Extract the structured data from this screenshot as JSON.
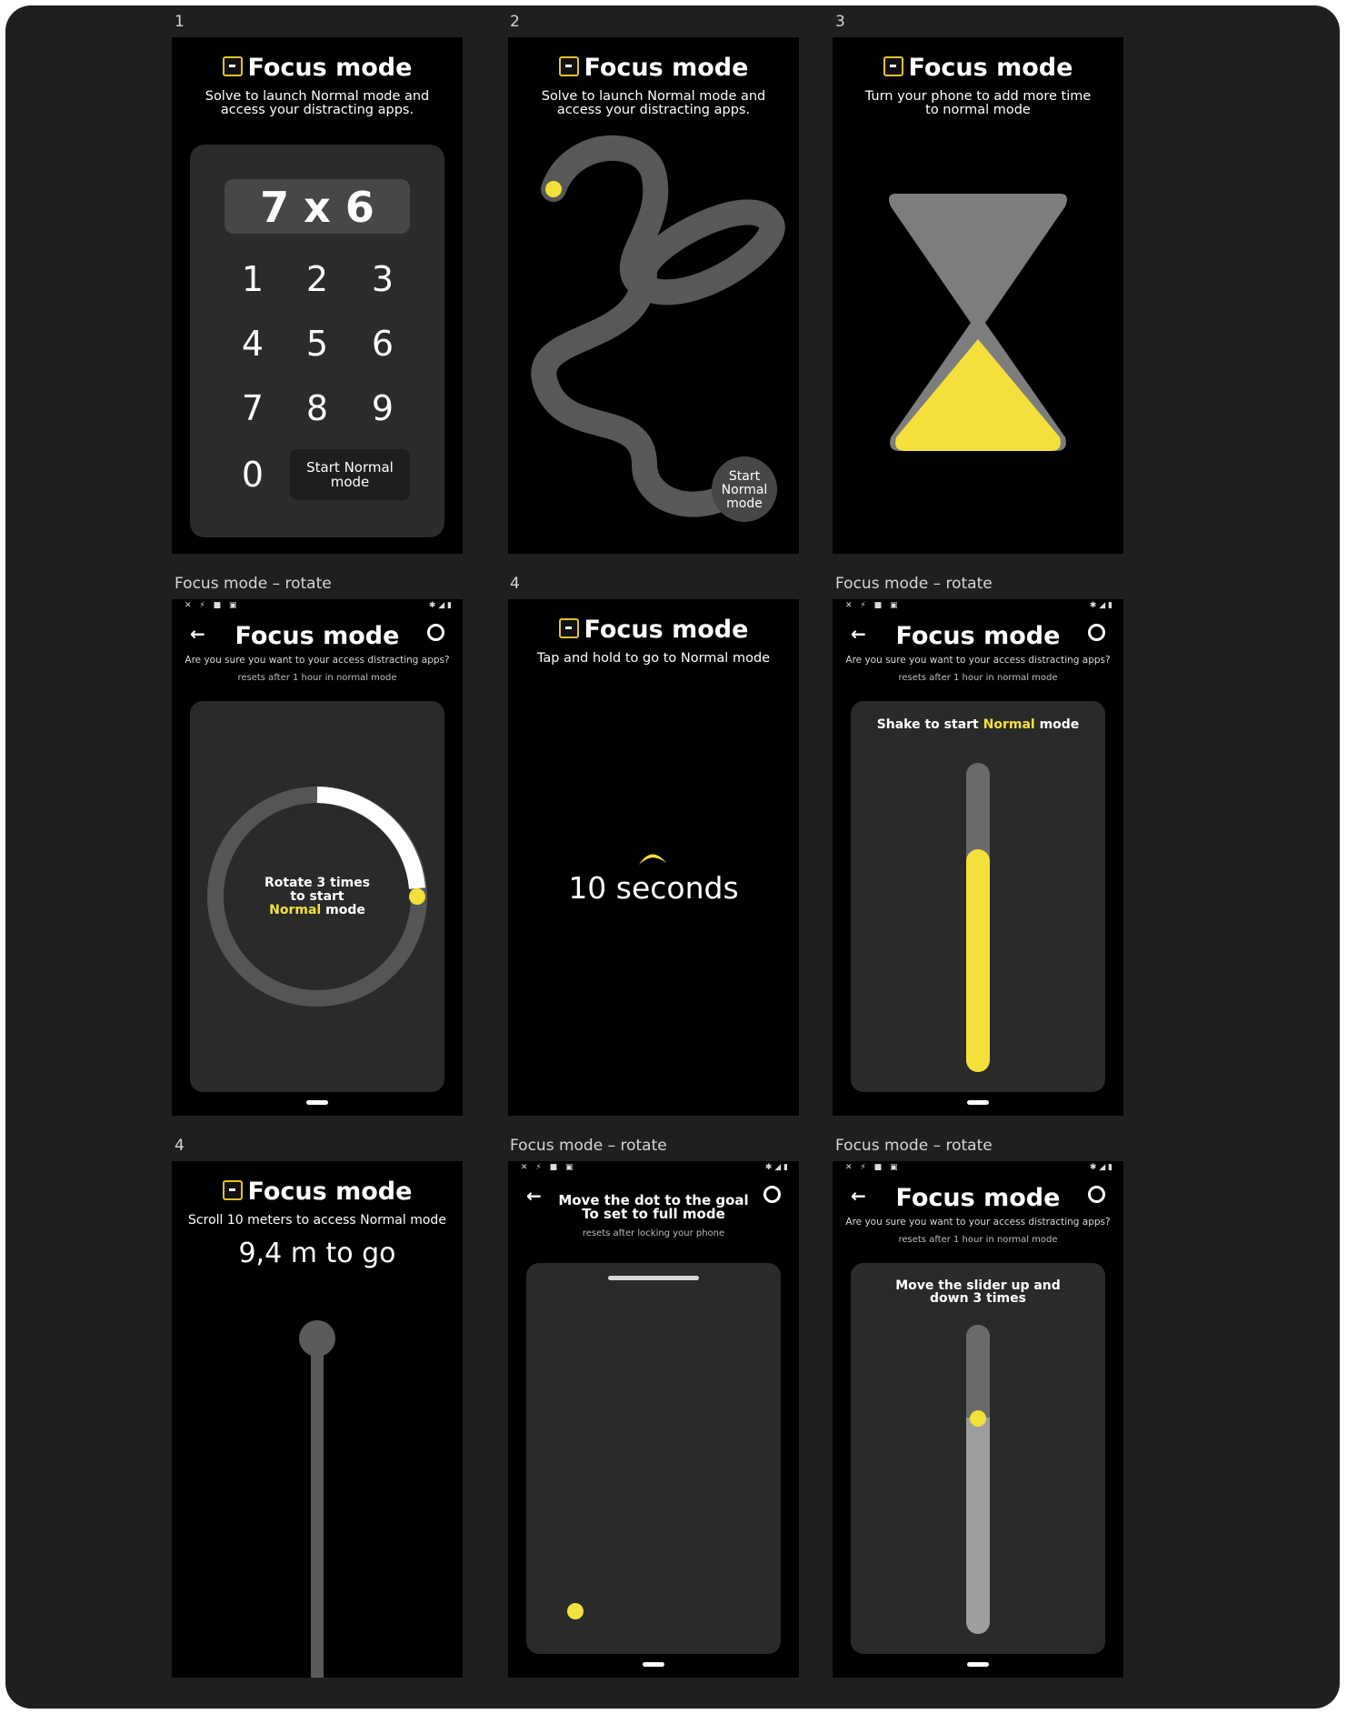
{
  "colors": {
    "accent": "#f3e03a",
    "board": "#1f1f1f",
    "track": "#555555"
  },
  "icons": [
    "focus-mode-logo-icon",
    "back-arrow-icon",
    "settings-gear-icon"
  ],
  "frames": [
    {
      "caption": "1",
      "title": "Focus mode",
      "subtitle": "Solve to launch Normal mode and access your distracting apps.",
      "equation": "7 x 6",
      "keys": [
        "1",
        "2",
        "3",
        "4",
        "5",
        "6",
        "7",
        "8",
        "9",
        "0"
      ],
      "start_button": "Start Normal mode"
    },
    {
      "caption": "2",
      "title": "Focus mode",
      "subtitle": "Solve to launch Normal mode and access your distracting apps.",
      "goal_label": "Start Normal mode"
    },
    {
      "caption": "3",
      "title": "Focus mode",
      "subtitle": "Turn your phone to add more time to normal mode"
    },
    {
      "caption": "Focus mode – rotate",
      "title": "Focus mode",
      "question": "Are you sure you want to your access distracting apps?",
      "note": "resets after 1 hour in normal mode",
      "center_line1": "Rotate 3 times",
      "center_line2": "to start",
      "center_highlight": "Normal",
      "center_line3": "mode",
      "progress_fraction": 0.3
    },
    {
      "caption": "4",
      "title": "Focus mode",
      "subtitle": "Tap and hold to go to Normal mode",
      "countdown": "10 seconds"
    },
    {
      "caption": "Focus mode – rotate",
      "title": "Focus mode",
      "question": "Are you sure you want to your access distracting apps?",
      "note": "resets after 1 hour in normal mode",
      "instruction_a": "Shake to start",
      "instruction_highlight": "Normal",
      "instruction_b": "mode",
      "fill_fraction": 0.72
    },
    {
      "caption": "4",
      "title": "Focus mode",
      "subtitle": "Scroll 10 meters to access Normal mode",
      "distance": "9,4 m to go"
    },
    {
      "caption": "Focus mode – rotate",
      "title": "Move the dot to the goal",
      "title2": "To set to full mode",
      "note": "resets after locking your phone"
    },
    {
      "caption": "Focus mode – rotate",
      "title": "Focus mode",
      "question": "Are you sure you want to your access distracting apps?",
      "note": "resets after 1 hour in normal mode",
      "instruction": "Move the slider up and down 3 times",
      "slider_fraction": 0.3
    }
  ]
}
